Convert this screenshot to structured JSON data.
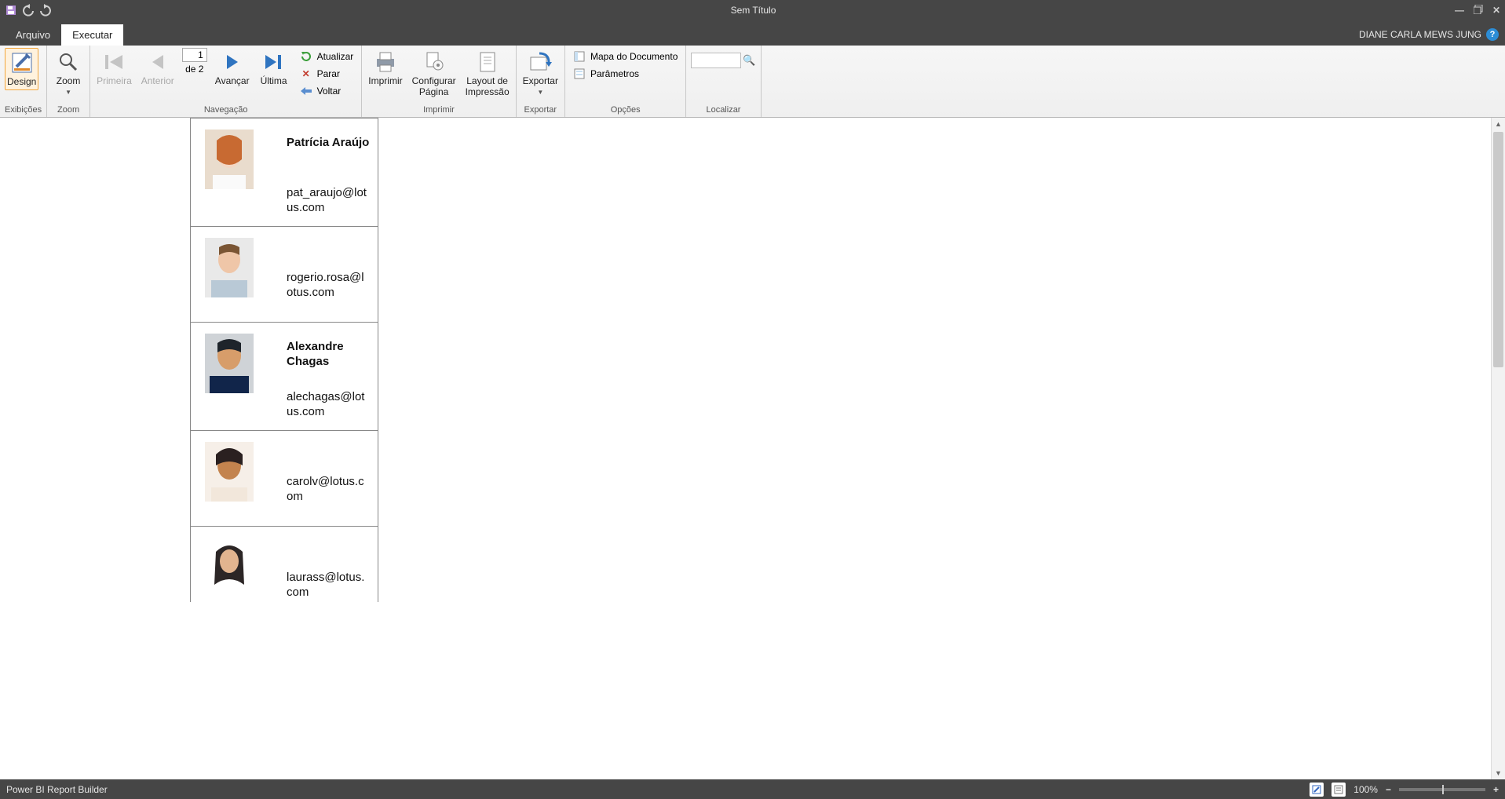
{
  "titlebar": {
    "title": "Sem Título"
  },
  "menubar": {
    "file": "Arquivo",
    "run": "Executar",
    "user": "DIANE CARLA MEWS JUNG"
  },
  "ribbon": {
    "groups": {
      "views": {
        "label": "Exibições",
        "design": "Design"
      },
      "zoom": {
        "label": "Zoom",
        "zoom": "Zoom"
      },
      "nav": {
        "label": "Navegação",
        "first": "Primeira",
        "prev": "Anterior",
        "next": "Avançar",
        "last": "Última",
        "refresh": "Atualizar",
        "stop": "Parar",
        "back": "Voltar",
        "page_current": "1",
        "page_of": "de 2"
      },
      "print": {
        "label": "Imprimir",
        "print": "Imprimir",
        "pagesetup": "Configurar Página",
        "printlayout": "Layout de Impressão"
      },
      "export": {
        "label": "Exportar",
        "export": "Exportar"
      },
      "options": {
        "label": "Opções",
        "docmap": "Mapa do Documento",
        "params": "Parâmetros"
      },
      "find": {
        "label": "Localizar"
      }
    }
  },
  "report": {
    "cards": [
      {
        "name": "Patrícia Araújo",
        "email": "pat_araujo@lotus.com",
        "photo": {
          "bg": "linear-gradient(#d9b79b,#f3e7dd)",
          "face": "#f2cdb4",
          "hair": "#b35a28"
        }
      },
      {
        "name": "",
        "email": "rogerio.rosa@lotus.com",
        "photo": {
          "bg": "#e7e7e7",
          "face": "#eec2a5",
          "hair": "#6b4a2c"
        }
      },
      {
        "name": "Alexandre Chagas",
        "email": "alechagas@lotus.com",
        "photo": {
          "bg": "#cfd3d7",
          "face": "#d8a174",
          "hair": "#23262b"
        }
      },
      {
        "name": "",
        "email": "carolv@lotus.com",
        "photo": {
          "bg": "#f6efe8",
          "face": "#c88a54",
          "hair": "#2a2020"
        }
      },
      {
        "name": "",
        "email": "laurass@lotus.com",
        "photo": {
          "bg": "#ffffff",
          "face": "#e2b48f",
          "hair": "#2c2626"
        }
      }
    ]
  },
  "status": {
    "app": "Power BI Report Builder",
    "zoom": "100%"
  }
}
